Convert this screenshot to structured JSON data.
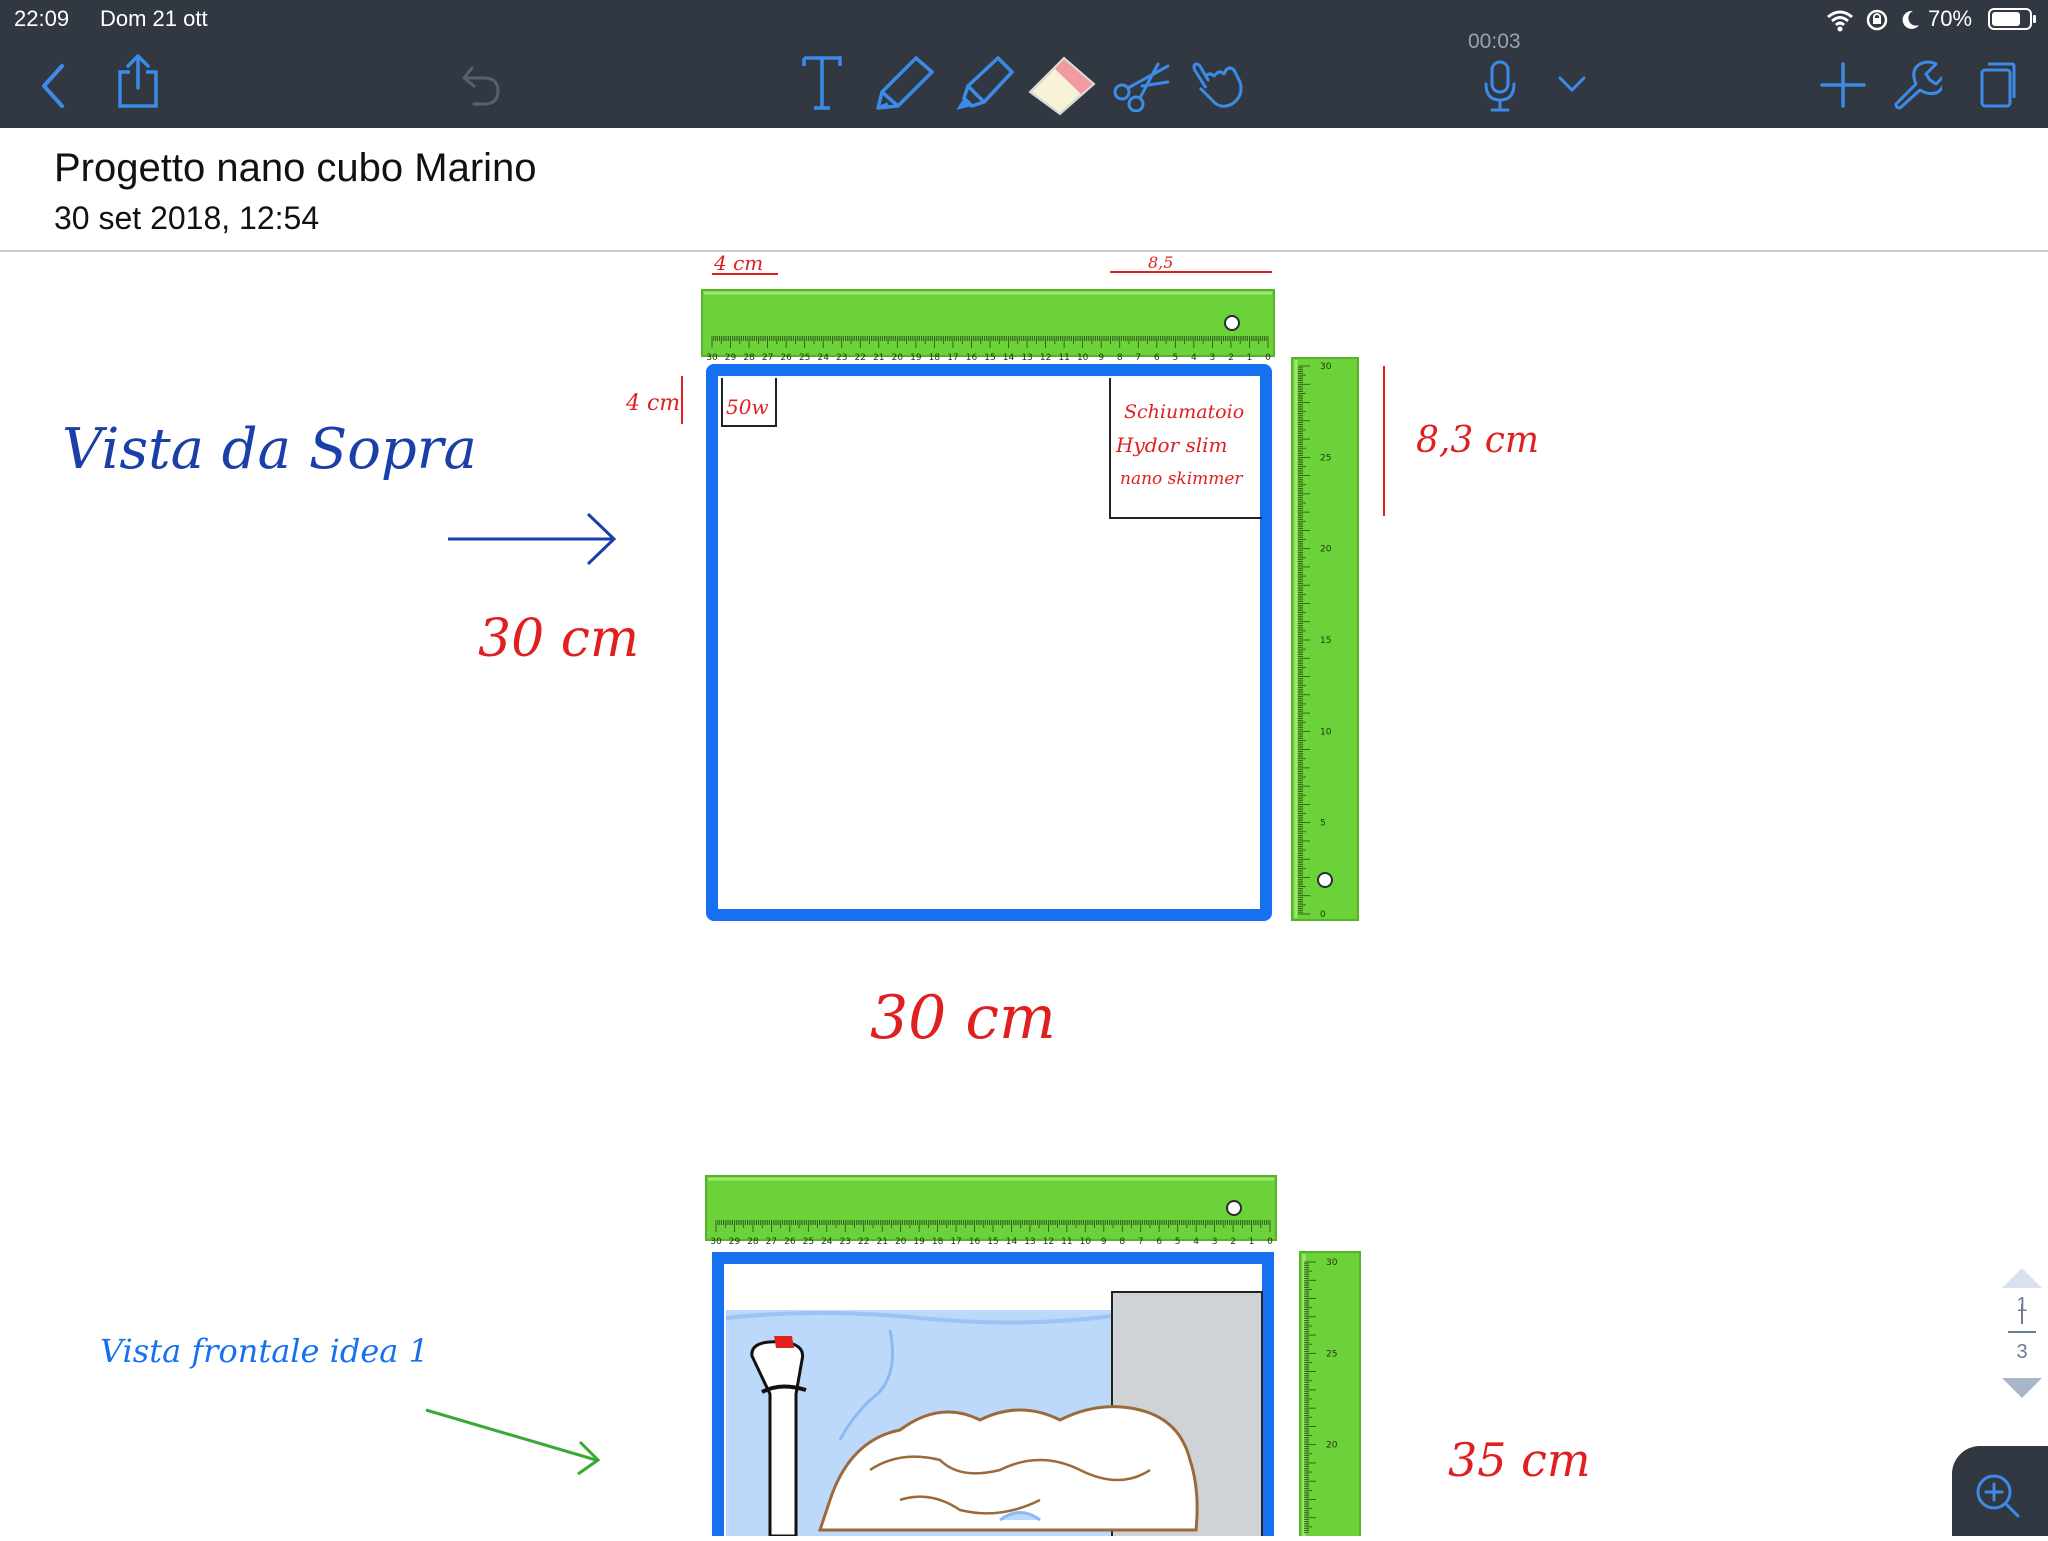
{
  "status_bar": {
    "time": "22:09",
    "date": "Dom 21 ott",
    "battery": "70%",
    "icons": [
      "wifi-icon",
      "rotation-lock-icon",
      "moon-icon",
      "battery-icon"
    ]
  },
  "toolbar": {
    "recording_time": "00:03",
    "icons": [
      "back-icon",
      "share-icon",
      "undo-icon",
      "text-tool-icon",
      "pen-tool-icon",
      "highlighter-tool-icon",
      "eraser-tool-icon",
      "scissors-tool-icon",
      "hand-tool-icon",
      "microphone-icon",
      "chevron-down-icon",
      "add-icon",
      "wrench-icon",
      "pages-icon"
    ],
    "accent_color": "#3d8be8"
  },
  "document": {
    "title": "Progetto nano cubo Marino",
    "date": "30 set 2018, 12:54"
  },
  "notes": {
    "top_left_dim": "4 cm",
    "top_right_dim": "8,5",
    "side_dim_left": "4 cm",
    "box_small_label": "50w",
    "skimmer_lines": [
      "Schiumatoio",
      "Hydor slim",
      "nano skimmer"
    ],
    "side_dim_right": "8,3 cm",
    "view_top": "Vista da Sopra",
    "dim_left_30": "30 cm",
    "dim_bottom_30": "30 cm",
    "view_front": "Vista frontale idea 1",
    "dim_35": "35 cm"
  },
  "ruler": {
    "color": "#6cd23a",
    "top_labels": [
      "30",
      "29",
      "28",
      "27",
      "26",
      "25",
      "24",
      "23",
      "22",
      "21",
      "20",
      "19",
      "18",
      "17",
      "16",
      "15",
      "14",
      "13",
      "12",
      "11",
      "10",
      "9",
      "8",
      "7",
      "6",
      "5",
      "4",
      "3",
      "2",
      "1",
      "0"
    ],
    "side_labels": [
      "30",
      "25",
      "20",
      "15",
      "10",
      "5",
      "0"
    ]
  },
  "colors": {
    "ink_blue": "#1b3fa8",
    "ink_red": "#e02020",
    "ink_green": "#3aa832",
    "frame_blue": "#1670f0",
    "rock_brown": "#9c6a3a",
    "water": "#bcd8fb"
  },
  "page_indicator": {
    "current": "1",
    "total": "3"
  }
}
